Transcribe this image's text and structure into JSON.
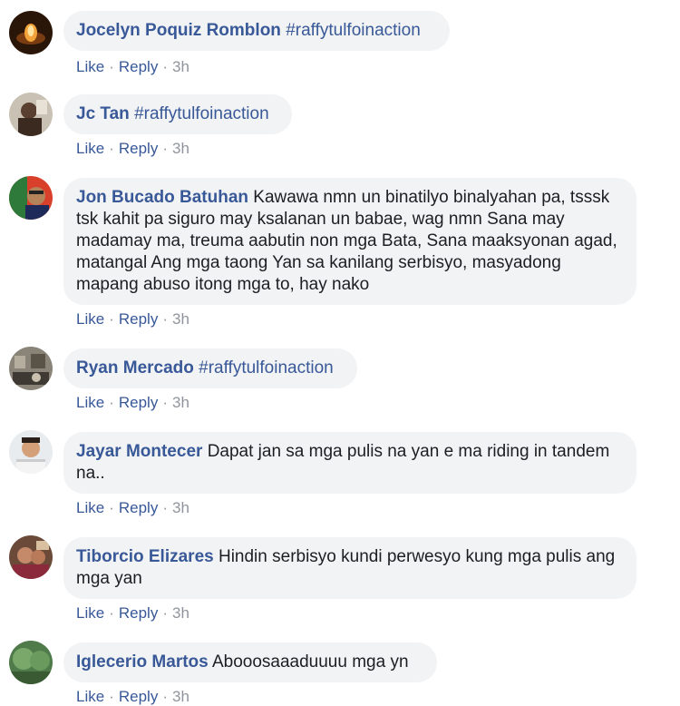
{
  "comments": [
    {
      "author": "Jocelyn Poquiz Romblon",
      "text": "#raffytulfoinaction",
      "text_is_tag": true,
      "like": "Like",
      "reply": "Reply",
      "time": "3h"
    },
    {
      "author": "Jc Tan",
      "text": "#raffytulfoinaction",
      "text_is_tag": true,
      "like": "Like",
      "reply": "Reply",
      "time": "3h"
    },
    {
      "author": "Jon Bucado Batuhan",
      "text": "Kawawa nmn un binatilyo binalyahan pa, tsssk tsk kahit pa siguro may ksalanan un babae, wag nmn Sana may madamay ma, treuma aabutin non mga Bata, Sana maaksyonan agad, matangal Ang mga taong Yan sa kanilang serbisyo, masyadong mapang abuso itong mga to, hay nako",
      "text_is_tag": false,
      "like": "Like",
      "reply": "Reply",
      "time": "3h"
    },
    {
      "author": "Ryan Mercado",
      "text": "#raffytulfoinaction",
      "text_is_tag": true,
      "like": "Like",
      "reply": "Reply",
      "time": "3h"
    },
    {
      "author": "Jayar Montecer",
      "text": "Dapat jan sa mga pulis na yan e ma riding in tandem na..",
      "text_is_tag": false,
      "like": "Like",
      "reply": "Reply",
      "time": "3h"
    },
    {
      "author": "Tiborcio Elizares",
      "text": "Hindin serbisyo kundi perwesyo kung mga pulis ang mga yan",
      "text_is_tag": false,
      "like": "Like",
      "reply": "Reply",
      "time": "3h"
    },
    {
      "author": "Iglecerio Martos",
      "text": "Abooosaaaduuuu mga yn",
      "text_is_tag": false,
      "like": "Like",
      "reply": "Reply",
      "time": "3h"
    }
  ],
  "colors": {
    "link": "#385898",
    "bubble": "#f2f3f5",
    "meta": "#90949c"
  }
}
